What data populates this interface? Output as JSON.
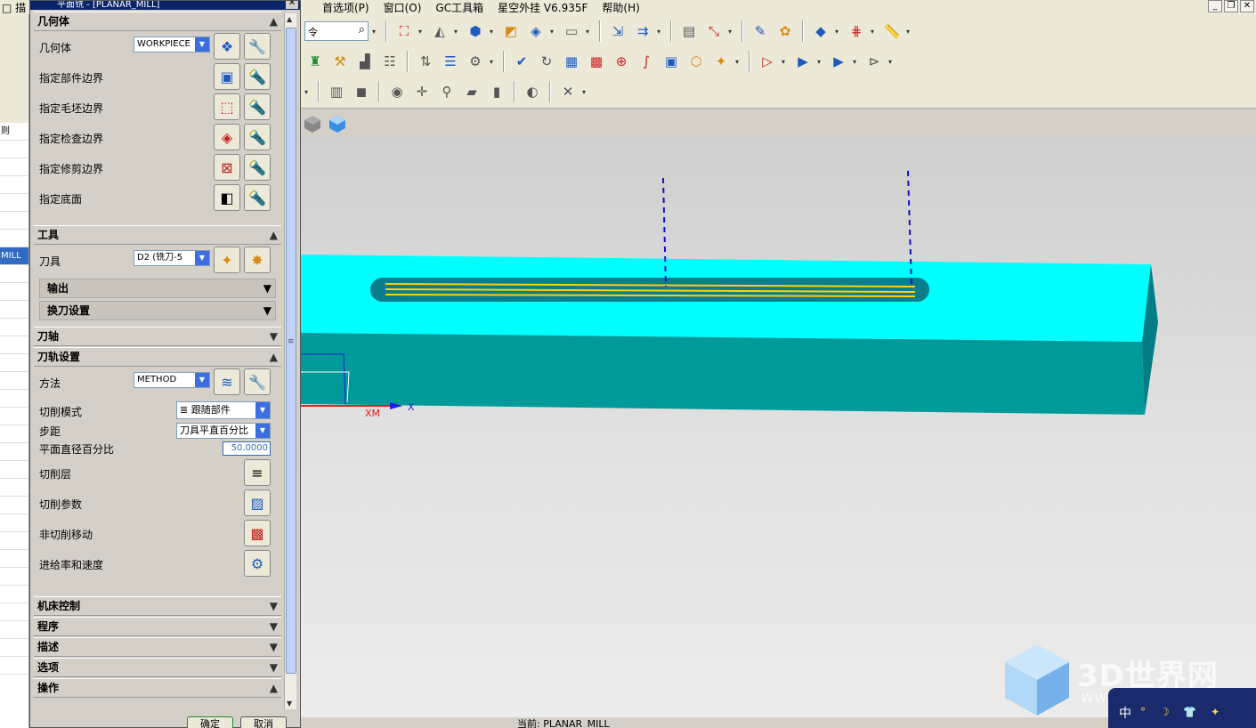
{
  "menubar": {
    "left_fragment": "□  描",
    "menus": [
      "首选项(P)",
      "窗口(O)",
      "GC工具箱",
      "星空外挂 V6.935F",
      "帮助(H)"
    ]
  },
  "toolbar": {
    "search_placeholder": "令"
  },
  "leftstrip": {
    "label": "则",
    "selected": "MILL"
  },
  "dialog": {
    "title": "平面铣 - [PLANAR_MILL]",
    "sections": {
      "geometry": "几何体",
      "tool": "工具",
      "tool_axis": "刀轴",
      "path_settings": "刀轨设置",
      "machine_control": "机床控制",
      "program": "程序",
      "description": "描述",
      "options": "选项",
      "actions": "操作"
    },
    "geometry_rows": {
      "geometry_label": "几何体",
      "geometry_value": "WORKPIECE",
      "part_boundary": "指定部件边界",
      "blank_boundary": "指定毛坯边界",
      "check_boundary": "指定检查边界",
      "trim_boundary": "指定修剪边界",
      "floor": "指定底面"
    },
    "tool_rows": {
      "tool_label": "刀具",
      "tool_value": "D2 (铣刀-5",
      "output": "输出",
      "tool_change": "换刀设置"
    },
    "path_rows": {
      "method_label": "方法",
      "method_value": "METHOD",
      "cut_pattern_label": "切削模式",
      "cut_pattern_value": "跟随部件",
      "stepover_label": "步距",
      "stepover_value": "刀具平直百分比",
      "percent_label": "平面直径百分比",
      "percent_value": "50.0000",
      "cut_levels": "切削层",
      "cut_params": "切削参数",
      "non_cutting": "非切削移动",
      "feeds_speeds": "进给率和速度"
    },
    "footer": {
      "ok": "确定",
      "cancel": "取消"
    }
  },
  "viewport": {
    "wcs_label": "XM",
    "axis_label": "X"
  },
  "status": {
    "text": "当前: PLANAR_MILL"
  },
  "watermark": {
    "brand": "3D世界网",
    "url": "WWW.3DSJW.COM"
  },
  "ime": {
    "lang": "中"
  },
  "colors": {
    "top_face": "#00ffff",
    "side_face": "#009a9a",
    "toolpath": "#ffd200",
    "pocket": "#0a7e8c",
    "title_bar": "#0a246a"
  }
}
